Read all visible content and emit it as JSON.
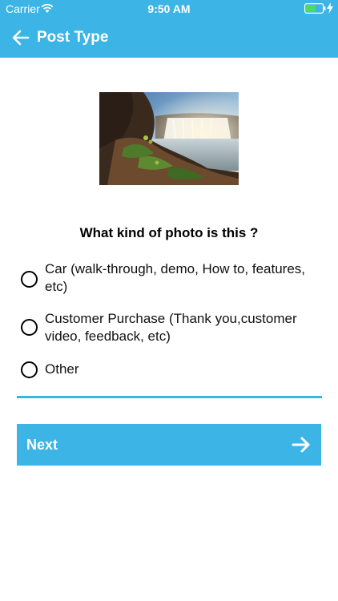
{
  "status_bar": {
    "carrier": "Carrier",
    "time": "9:50 AM",
    "wifi_icon": "wifi-icon",
    "battery_icon": "battery-icon",
    "charging_icon": "charging-bolt-icon",
    "battery_level": 0.6
  },
  "nav": {
    "title": "Post Type",
    "back_icon": "arrow-left-icon"
  },
  "photo": {
    "subject": "waterfall landscape photo"
  },
  "question": "What kind of photo is this ?",
  "options": [
    {
      "label": "Car (walk-through, demo, How to, features, etc)",
      "selected": false
    },
    {
      "label": "Customer Purchase (Thank you,customer video, feedback, etc)",
      "selected": false
    },
    {
      "label": "Other",
      "selected": false
    }
  ],
  "next_button": {
    "label": "Next",
    "icon": "arrow-right-icon"
  },
  "colors": {
    "accent": "#3cb4e5",
    "text": "#000000",
    "background": "#ffffff"
  }
}
